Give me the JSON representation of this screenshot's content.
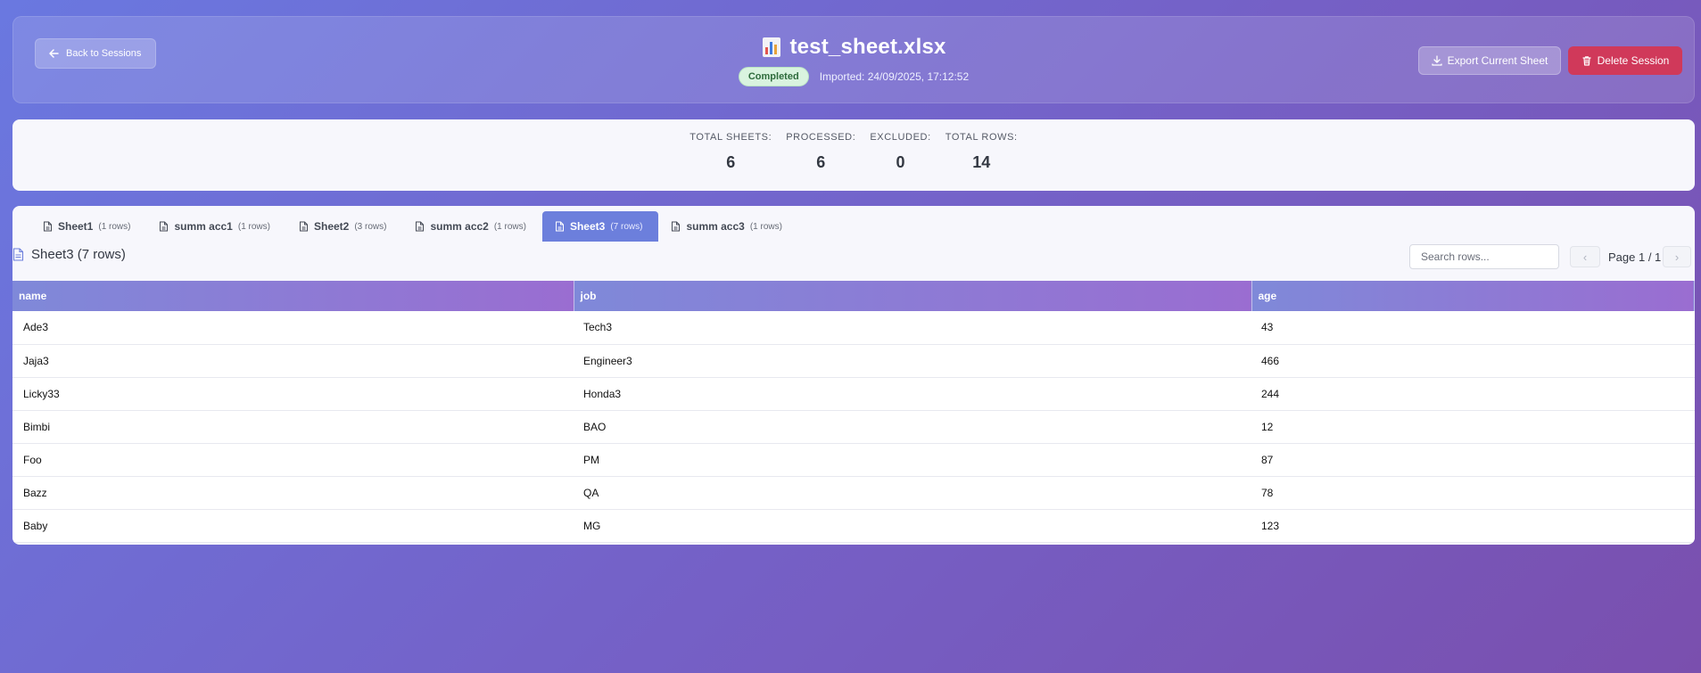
{
  "header": {
    "back_label": "Back to Sessions",
    "file_name": "test_sheet.xlsx",
    "status": "Completed",
    "imported": "Imported: 24/09/2025, 17:12:52",
    "export_label": "Export Current Sheet",
    "delete_label": "Delete Session"
  },
  "stats": {
    "total_sheets_label": "TOTAL SHEETS:",
    "total_sheets": "6",
    "processed_label": "PROCESSED:",
    "processed": "6",
    "excluded_label": "EXCLUDED:",
    "excluded": "0",
    "total_rows_label": "TOTAL ROWS:",
    "total_rows": "14"
  },
  "tabs": [
    {
      "name": "Sheet1",
      "count": "(1 rows)"
    },
    {
      "name": "summ acc1",
      "count": "(1 rows)"
    },
    {
      "name": "Sheet2",
      "count": "(3 rows)"
    },
    {
      "name": "summ acc2",
      "count": "(1 rows)"
    },
    {
      "name": "Sheet3",
      "count": "(7 rows)"
    },
    {
      "name": "summ acc3",
      "count": "(1 rows)"
    }
  ],
  "sheet": {
    "title": "Sheet3 (7 rows)",
    "search_placeholder": "Search rows...",
    "page_label": "Page 1 / 1",
    "prev_glyph": "‹",
    "next_glyph": "›"
  },
  "table": {
    "columns": [
      "name",
      "job",
      "age"
    ],
    "rows": [
      [
        "Ade3",
        "Tech3",
        "43"
      ],
      [
        "Jaja3",
        "Engineer3",
        "466"
      ],
      [
        "Licky33",
        "Honda3",
        "244"
      ],
      [
        "Bimbi",
        "BAO",
        "12"
      ],
      [
        "Foo",
        "PM",
        "87"
      ],
      [
        "Bazz",
        "QA",
        "78"
      ],
      [
        "Baby",
        "MG",
        "123"
      ]
    ]
  },
  "colors": {
    "accent": "#6c7fdc",
    "danger": "#d0395a",
    "badge_bg": "#d9f3df"
  }
}
